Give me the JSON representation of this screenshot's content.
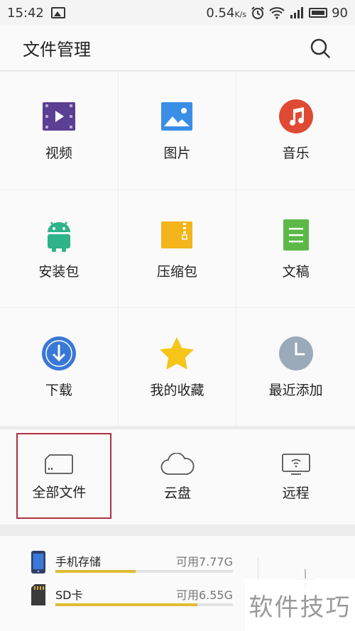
{
  "status_bar": {
    "time": "15:42",
    "net_speed": "0.54",
    "net_unit": "K/s",
    "battery": "90"
  },
  "header": {
    "title": "文件管理"
  },
  "categories": [
    {
      "label": "视频"
    },
    {
      "label": "图片"
    },
    {
      "label": "音乐"
    },
    {
      "label": "安装包"
    },
    {
      "label": "压缩包"
    },
    {
      "label": "文稿"
    },
    {
      "label": "下载"
    },
    {
      "label": "我的收藏"
    },
    {
      "label": "最近添加"
    }
  ],
  "quick": [
    {
      "label": "全部文件"
    },
    {
      "label": "云盘"
    },
    {
      "label": "远程"
    }
  ],
  "storage": [
    {
      "name": "手机存储",
      "free": "可用7.77G",
      "used_fraction": 0.45
    },
    {
      "name": "SD卡",
      "free": "可用6.55G",
      "used_fraction": 0.8
    }
  ],
  "watermark": {
    "text": "软件技巧"
  },
  "colors": {
    "accent_yellow": "#e0bc36",
    "highlight_red": "#b0303e"
  }
}
